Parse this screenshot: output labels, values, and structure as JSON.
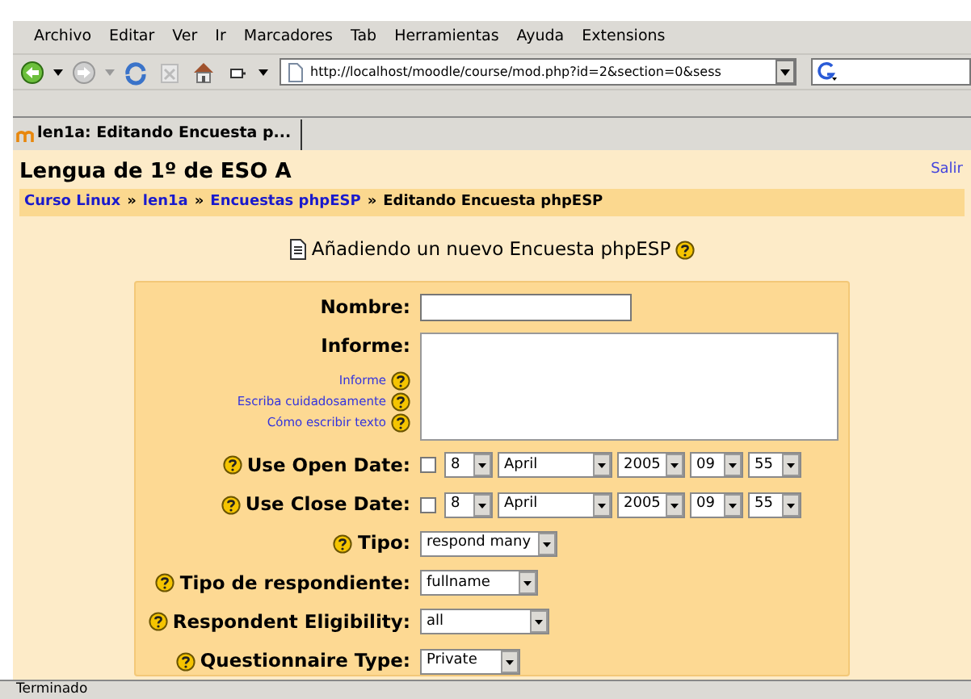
{
  "menu": [
    "Archivo",
    "Editar",
    "Ver",
    "Ir",
    "Marcadores",
    "Tab",
    "Herramientas",
    "Ayuda",
    "Extensions"
  ],
  "address": {
    "value": "http://localhost/moodle/course/mod.php?id=2&section=0&sess"
  },
  "tabs": [
    {
      "label": "len1a: Editando Encuesta p...",
      "selected": true
    }
  ],
  "page": {
    "title": "Lengua de 1º de ESO A",
    "logout": "Salir",
    "breadcrumb": {
      "links": [
        "Curso Linux",
        "len1a",
        "Encuestas phpESP"
      ],
      "separator": "»",
      "current": "Editando Encuesta phpESP"
    },
    "heading": "Añadiendo un nuevo Encuesta phpESP"
  },
  "form": [
    {
      "kind": "text",
      "label": "Nombre:"
    },
    {
      "kind": "textarea",
      "label": "Informe:",
      "help_links": [
        "Informe",
        "Escriba cuidadosamente",
        "Cómo escribir texto"
      ]
    },
    {
      "kind": "date",
      "label": "Use Open Date:",
      "checked": false,
      "day": "8",
      "month": "April",
      "year": "2005",
      "hour": "09",
      "minute": "55"
    },
    {
      "kind": "date",
      "label": "Use Close Date:",
      "checked": false,
      "day": "8",
      "month": "April",
      "year": "2005",
      "hour": "09",
      "minute": "55"
    },
    {
      "kind": "select",
      "label": "Tipo:",
      "value": "respond many"
    },
    {
      "kind": "select",
      "label": "Tipo de respondiente:",
      "value": "fullname"
    },
    {
      "kind": "select",
      "label": "Respondent Eligibility:",
      "value": "all"
    },
    {
      "kind": "select",
      "label": "Questionnaire Type:",
      "value": "Private"
    }
  ],
  "status_bar": "Terminado"
}
